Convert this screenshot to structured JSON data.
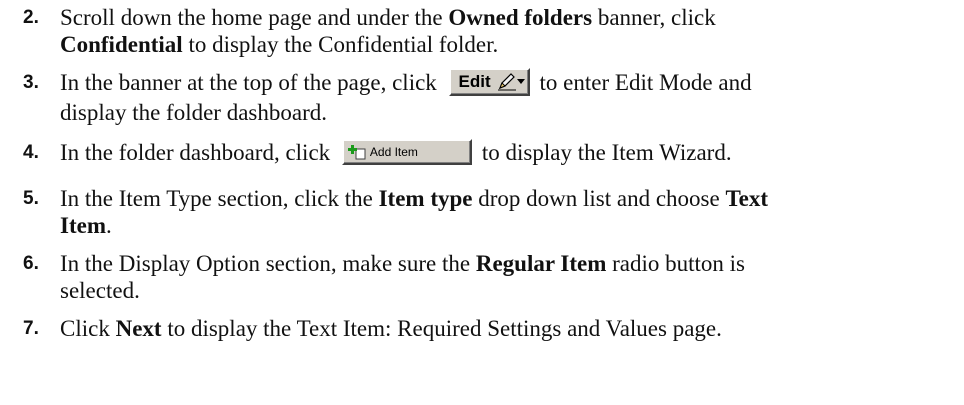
{
  "steps": [
    {
      "num": "2.",
      "l1_a": "Scroll down the home page and under the ",
      "l1_b": "Owned folders",
      "l1_c": " banner, click",
      "l2_a": "Confidential",
      "l2_b": " to display the Confidential folder."
    },
    {
      "num": "3.",
      "l1_a": "In the banner at the top of the page, click",
      "l1_c": "to enter Edit Mode and",
      "l2": "display the folder dashboard.",
      "button_label": "Edit"
    },
    {
      "num": "4.",
      "l1_a": "In the folder dashboard, click",
      "l1_c": "to display the Item Wizard.",
      "button_label": "Add Item"
    },
    {
      "num": "5.",
      "l1_a": "In the Item Type section, click the ",
      "l1_b": "Item type",
      "l1_c": " drop down list and choose ",
      "l1_d": "Text",
      "l2_a": "Item",
      "l2_b": "."
    },
    {
      "num": "6.",
      "l1_a": "In the Display Option section, make sure the ",
      "l1_b": "Regular Item",
      "l1_c": " radio button is",
      "l2": "selected."
    },
    {
      "num": "7.",
      "l1_a": "Click ",
      "l1_b": "Next",
      "l1_c": " to display the Text Item: Required Settings and Values page."
    }
  ],
  "icons": {
    "edit_button": "pencil-icon",
    "add_item_button": "plus-icon"
  },
  "colors": {
    "button_face": "#d4d0c8",
    "plus_green": "#1a9a1a"
  }
}
